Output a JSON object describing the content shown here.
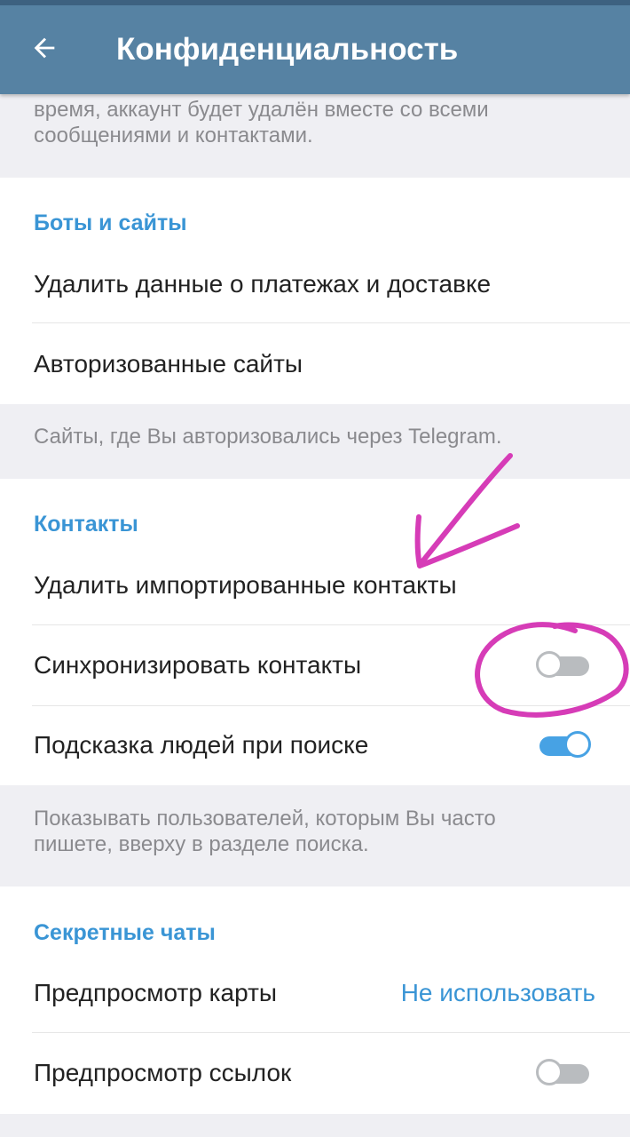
{
  "appbar": {
    "title": "Конфиденциальность",
    "back_icon": "arrow-left-icon"
  },
  "top_info": {
    "text_line1": "время, аккаунт будет удалён вместе со всеми",
    "text_line2": "сообщениями и контактами."
  },
  "bots_section": {
    "header": "Боты и сайты",
    "items": [
      {
        "label": "Удалить данные о платежах и доставке"
      },
      {
        "label": "Авторизованные сайты"
      }
    ],
    "footer": "Сайты, где Вы авторизовались через Telegram."
  },
  "contacts_section": {
    "header": "Контакты",
    "items": [
      {
        "label": "Удалить импортированные контакты"
      },
      {
        "label": "Синхронизировать контакты",
        "toggle": "off"
      },
      {
        "label": "Подсказка людей при поиске",
        "toggle": "on"
      }
    ],
    "footer_line1": "Показывать пользователей, которым Вы часто",
    "footer_line2": "пишете, вверху в разделе поиска."
  },
  "secret_section": {
    "header": "Секретные чаты",
    "items": [
      {
        "label": "Предпросмотр карты",
        "value": "Не использовать"
      },
      {
        "label": "Предпросмотр ссылок",
        "toggle": "off"
      }
    ]
  },
  "colors": {
    "appbar": "#5682a3",
    "accent": "#3a95d5",
    "toggle_on": "#47a2e4",
    "toggle_off": "#b9bcbf",
    "annotation": "#d63cb7"
  }
}
